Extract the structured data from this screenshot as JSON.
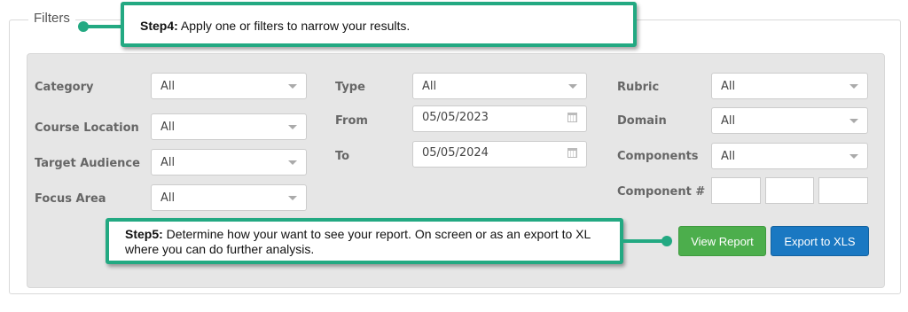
{
  "filters": {
    "legend": "Filters",
    "col1": [
      {
        "label": "Category",
        "value": "All"
      },
      {
        "label": "Course Location",
        "value": "All"
      },
      {
        "label": "Target Audience",
        "value": "All"
      },
      {
        "label": "Focus Area",
        "value": "All"
      }
    ],
    "col2": {
      "type_label": "Type",
      "type_value": "All",
      "from_label": "From",
      "from_value": "05/05/2023",
      "to_label": "To",
      "to_value": "05/05/2024"
    },
    "col3": [
      {
        "label": "Rubric",
        "value": "All"
      },
      {
        "label": "Domain",
        "value": "All"
      },
      {
        "label": "Components",
        "value": "All"
      }
    ],
    "component_num_label": "Component #"
  },
  "buttons": {
    "view_report": "View Report",
    "export_xls": "Export to XLS"
  },
  "callouts": {
    "step4_title": "Step4:",
    "step4_text": " Apply one or filters to narrow your results.",
    "step5_title": "Step5:",
    "step5_text": " Determine how your want to see your report. On screen or as an export to XL where you can do further analysis."
  },
  "colors": {
    "callout_border": "#23a982",
    "view_report_bg": "#4cae4c",
    "export_bg": "#1a78c2"
  }
}
